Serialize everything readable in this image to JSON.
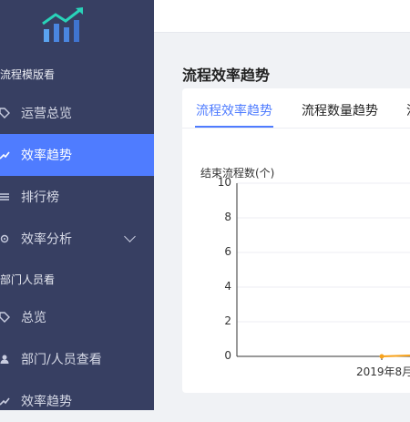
{
  "sidebar": {
    "group1_label": "流程模版看",
    "group1_items": [
      {
        "label": "运营总览",
        "icon": "tag-icon"
      },
      {
        "label": "效率趋势",
        "icon": "trend-icon",
        "active": true
      },
      {
        "label": "排行榜",
        "icon": "list-icon"
      },
      {
        "label": "效率分析",
        "icon": "gear-icon",
        "has_submenu": true
      }
    ],
    "group2_label": "部门人员看",
    "group2_items": [
      {
        "label": "总览",
        "icon": "tag-icon"
      },
      {
        "label": "部门/人员查看",
        "icon": "user-icon"
      },
      {
        "label": "效率趋势",
        "icon": "trend-icon"
      }
    ]
  },
  "main": {
    "section_title": "流程效率趋势",
    "tabs": [
      {
        "label": "流程效率趋势",
        "active": true
      },
      {
        "label": "流程数量趋势"
      },
      {
        "label": "流"
      }
    ]
  },
  "colors": {
    "sidebar_bg": "#373f62",
    "accent": "#4f7cff",
    "series": "#f7a21b"
  },
  "chart_data": {
    "type": "line",
    "ylabel": "结束流程数(个)",
    "ylim": [
      0,
      10
    ],
    "yticks": [
      "10",
      "8",
      "6",
      "4",
      "2",
      "0"
    ],
    "x": [
      "2019年8月"
    ],
    "series": [
      {
        "values": [
          0
        ]
      }
    ]
  }
}
